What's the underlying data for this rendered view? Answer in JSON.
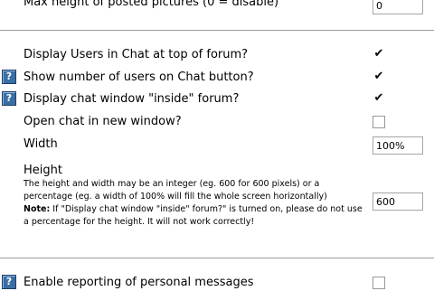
{
  "settings": {
    "max_height": {
      "label": "Max height of posted pictures (0 = disable)",
      "value": "0"
    },
    "display_users": {
      "label": "Display Users in Chat at top of forum?",
      "checked": true
    },
    "show_number": {
      "label": "Show number of users on Chat button?",
      "checked": true
    },
    "display_inside": {
      "label": "Display chat window \"inside\" forum?",
      "checked": true
    },
    "open_new_window": {
      "label": "Open chat in new window?",
      "checked": false
    },
    "width": {
      "label": "Width",
      "value": "100%"
    },
    "height": {
      "label": "Height",
      "description": "The height and width may be an integer (eg. 600 for 600 pixels) or a percentage (eg. a width of 100% will fill the whole screen horizontally)",
      "note_label": "Note:",
      "note_text": " If \"Display chat window \"inside\" forum?\" is turned on, please do not use a percentage for the height. It will not work correctly!",
      "value": "600"
    },
    "enable_reporting": {
      "label": "Enable reporting of personal messages",
      "checked": false
    }
  },
  "icons": {
    "help": "help-icon",
    "checkmark": "✔"
  },
  "colors": {
    "help_icon": "#3a6ea5",
    "separator": "#9a9a9a"
  }
}
